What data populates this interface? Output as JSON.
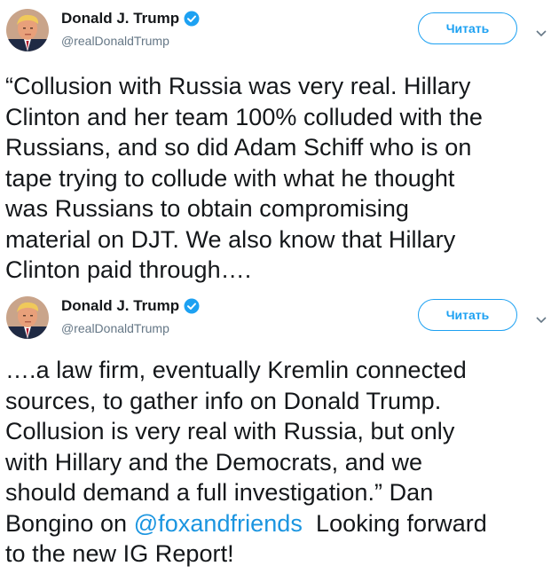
{
  "tweets": [
    {
      "author_name": "Donald J. Trump",
      "handle": "@realDonaldTrump",
      "follow_label": "Читать",
      "lines": [
        "“Collusion with Russia was very real. Hillary",
        "Clinton and her team 100% colluded with the",
        "Russians, and so did Adam Schiff who is on",
        "tape trying to collude with what he thought",
        "was Russians to obtain compromising",
        "material on DJT. We also know that Hillary",
        "Clinton paid through…."
      ]
    },
    {
      "author_name": "Donald J. Trump",
      "handle": "@realDonaldTrump",
      "follow_label": "Читать",
      "lines": [
        "….a law firm, eventually Kremlin connected",
        "sources, to gather info on Donald Trump.",
        "Collusion is very real with Russia, but only",
        "with Hillary and the Democrats, and we",
        "should demand a full investigation.” Dan"
      ],
      "line6_before": "Bongino on ",
      "mention": "@foxandfriends",
      "line6_after": "  Looking forward",
      "line7": "to the new IG Report!"
    }
  ],
  "colors": {
    "accent": "#1da1f2",
    "mention": "#1b95e0",
    "secondary_text": "#657786",
    "verified_badge": "#1da1f2"
  },
  "icons": {
    "verified": "verified-badge-icon",
    "more": "chevron-down-icon"
  }
}
